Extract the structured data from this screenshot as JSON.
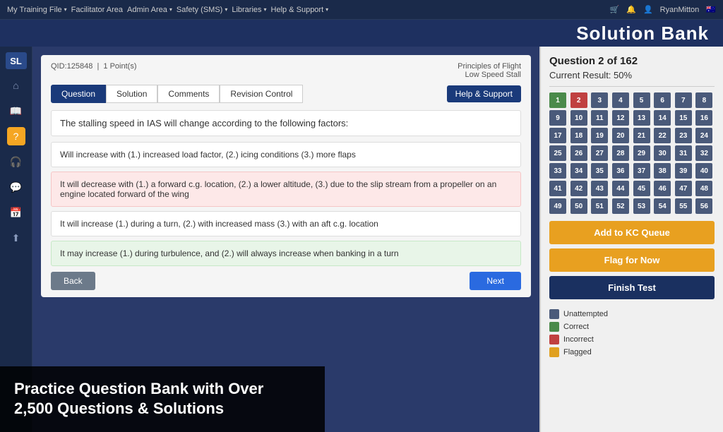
{
  "topnav": {
    "items": [
      {
        "label": "My Training File",
        "has_chevron": true
      },
      {
        "label": "Facilitator Area",
        "has_chevron": false
      },
      {
        "label": "Admin Area",
        "has_chevron": true
      },
      {
        "label": "Safety (SMS)",
        "has_chevron": true
      },
      {
        "label": "Libraries",
        "has_chevron": true
      },
      {
        "label": "Help & Support",
        "has_chevron": true
      }
    ],
    "user": "RyanMitton",
    "icons": [
      "cart",
      "bell",
      "profile"
    ]
  },
  "header": {
    "title": "Solution Bank"
  },
  "sidebar": {
    "logo": "SL",
    "icons": [
      "home",
      "book",
      "question",
      "headphone",
      "chat",
      "calendar",
      "upload"
    ]
  },
  "question_card": {
    "qid": "QID:125848",
    "points": "1 Point(s)",
    "category1": "Principles of Flight",
    "category2": "Low Speed Stall",
    "tabs": [
      "Question",
      "Solution",
      "Comments",
      "Revision Control"
    ],
    "active_tab": "Question",
    "help_support_label": "Help & Support"
  },
  "question": {
    "text": "The stalling speed in IAS will change according to the following factors:"
  },
  "answers": [
    {
      "id": "a",
      "text": "Will increase with (1.) increased load factor, (2.) icing conditions (3.) more flaps",
      "state": "normal"
    },
    {
      "id": "b",
      "text": "It will decrease with (1.) a forward c.g. location, (2.) a lower altitude, (3.) due to the slip stream from a propeller on an engine located forward of the wing",
      "state": "incorrect"
    },
    {
      "id": "c",
      "text": "It will increase (1.) during a turn, (2.) with increased mass (3.) with an aft c.g. location",
      "state": "normal"
    },
    {
      "id": "d",
      "text": "It may increase (1.) during turbulence, and (2.) will always increase when banking in a turn",
      "state": "correct"
    }
  ],
  "buttons": {
    "back": "Back",
    "next": "Next"
  },
  "right_panel": {
    "title": "Question 2 of 162",
    "current_result_label": "Current Result: 50%",
    "add_kc_queue": "Add to KC Queue",
    "flag_for_now": "Flag for Now",
    "finish_test": "Finish Test",
    "legend": [
      {
        "key": "unattempted",
        "label": "Unattempted"
      },
      {
        "key": "correct",
        "label": "Correct"
      },
      {
        "key": "incorrect",
        "label": "Incorrect"
      },
      {
        "key": "flagged",
        "label": "Flagged"
      }
    ]
  },
  "grid": {
    "total": 56,
    "states": {
      "1": "correct",
      "2": "incorrect"
    }
  },
  "overlay": {
    "line1": "Practice Question Bank with Over",
    "line2": "2,500 Questions & Solutions"
  }
}
